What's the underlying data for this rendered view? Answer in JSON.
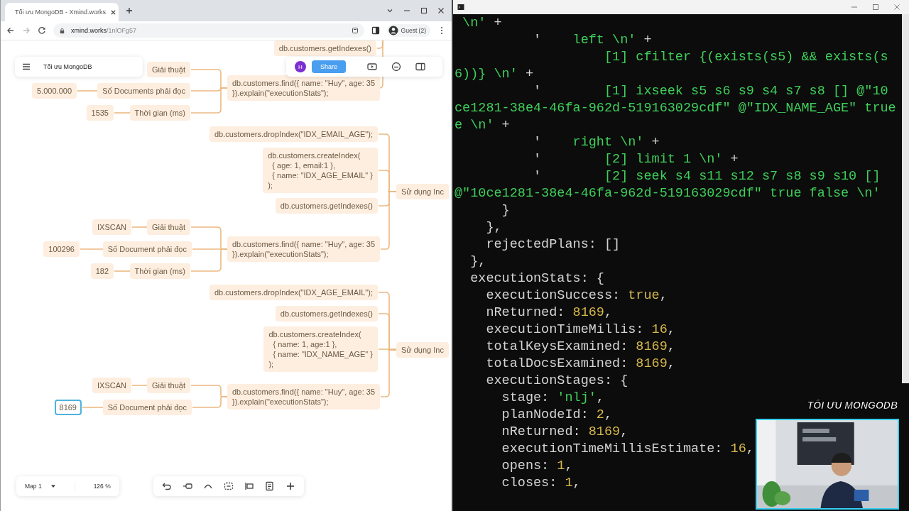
{
  "browser": {
    "tab": {
      "title": "Tối ưu MongoDB - Xmind.works",
      "selected": true
    },
    "url_host": "xmind.works",
    "url_path": "/1nlOFg57",
    "profile": "Guest (2)"
  },
  "app": {
    "title": "Tối ưu MongoDB",
    "avatar": "H",
    "share": "Share",
    "map_tab": "Map 1",
    "zoom": "126 %"
  },
  "mind_map": {
    "branches": [
      {
        "children": [
          {
            "text": "db.customers.getIndexes()",
            "selected": false
          },
          {
            "text": "db.customers.find({ name: \"Huy\", age: 35\n}).explain(\"executionStats\");",
            "selected": false,
            "children": [
              {
                "text": "Giải thuật",
                "selected": false
              },
              {
                "text": "Số Documents phải đọc",
                "selected": false,
                "children": [
                  {
                    "text": "5.000.000",
                    "selected": false
                  }
                ]
              },
              {
                "text": "Thời gian (ms)",
                "selected": false,
                "children": [
                  {
                    "text": "1535",
                    "selected": false
                  }
                ]
              }
            ]
          }
        ]
      },
      {
        "topic": {
          "text": "Sử dụng Inc",
          "selected": false
        },
        "children": [
          {
            "text": "db.customers.dropIndex(\"IDX_EMAIL_AGE\");",
            "selected": false
          },
          {
            "text": "db.customers.createIndex(\n  { age: 1, email:1 },\n  { name: \"IDX_AGE_EMAIL\" }\n);",
            "selected": false
          },
          {
            "text": "db.customers.getIndexes()",
            "selected": false
          },
          {
            "text": "db.customers.find({ name: \"Huy\", age: 35\n}).explain(\"executionStats\");",
            "selected": false,
            "children": [
              {
                "text": "Giải thuật",
                "selected": false,
                "children": [
                  {
                    "text": "IXSCAN",
                    "selected": false
                  }
                ]
              },
              {
                "text": "Số Document phải đọc",
                "selected": false,
                "children": [
                  {
                    "text": "100296",
                    "selected": false
                  }
                ]
              },
              {
                "text": "Thời gian (ms)",
                "selected": false,
                "children": [
                  {
                    "text": "182",
                    "selected": false
                  }
                ]
              }
            ]
          }
        ]
      },
      {
        "topic": {
          "text": "Sử dụng Inc",
          "selected": false
        },
        "children": [
          {
            "text": "db.customers.dropIndex(\"IDX_AGE_EMAIL\");",
            "selected": false
          },
          {
            "text": "db.customers.getIndexes()",
            "selected": false
          },
          {
            "text": "db.customers.createIndex(\n  { name: 1, age:1 },\n  { name: \"IDX_NAME_AGE\" }\n);",
            "selected": false
          },
          {
            "text": "db.customers.find({ name: \"Huy\", age: 35\n}).explain(\"executionStats\");",
            "selected": false,
            "children": [
              {
                "text": "Giải thuật",
                "selected": false,
                "children": [
                  {
                    "text": "IXSCAN",
                    "selected": false
                  }
                ]
              },
              {
                "text": "Số Document phải đọc",
                "selected": false,
                "children": [
                  {
                    "text": "8169",
                    "selected": true
                  }
                ]
              }
            ]
          }
        ]
      }
    ]
  },
  "terminal": {
    "lines": [
      [
        {
          "text": " \\n'",
          "kind": "str"
        },
        {
          "text": " +",
          "kind": "plain"
        }
      ],
      [
        {
          "text": "          '    ",
          "kind": "plain"
        },
        {
          "text": "left \\n'",
          "kind": "str"
        },
        {
          "text": " +",
          "kind": "plain"
        }
      ],
      [
        {
          "text": "                   [1] cfilter {(exists(s5) && exists(s",
          "kind": "str"
        }
      ],
      [
        {
          "text": "6))} \\n'",
          "kind": "str"
        },
        {
          "text": " +",
          "kind": "plain"
        }
      ],
      [
        {
          "text": "          '        ",
          "kind": "plain"
        },
        {
          "text": "[1] ixseek s5 s6 s9 s4 s7 s8 [] @\"10",
          "kind": "str"
        }
      ],
      [
        {
          "text": "ce1281-38e4-46fa-962d-519163029cdf\" @\"IDX_NAME_AGE\" true",
          "kind": "str"
        }
      ],
      [
        {
          "text": "e \\n'",
          "kind": "str"
        },
        {
          "text": " +",
          "kind": "plain"
        }
      ],
      [
        {
          "text": "          '    ",
          "kind": "plain"
        },
        {
          "text": "right \\n'",
          "kind": "str"
        },
        {
          "text": " +",
          "kind": "plain"
        }
      ],
      [
        {
          "text": "          '        ",
          "kind": "plain"
        },
        {
          "text": "[2] limit 1 \\n'",
          "kind": "str"
        },
        {
          "text": " +",
          "kind": "plain"
        }
      ],
      [
        {
          "text": "          '        ",
          "kind": "plain"
        },
        {
          "text": "[2] seek s4 s11 s12 s7 s8 s9 s10 []",
          "kind": "str"
        }
      ],
      [
        {
          "text": "@\"10ce1281-38e4-46fa-962d-519163029cdf\" true false \\n'",
          "kind": "str"
        }
      ],
      [
        {
          "text": "      }",
          "kind": "plain"
        }
      ],
      [
        {
          "text": "    },",
          "kind": "plain"
        }
      ],
      [
        {
          "text": "    rejectedPlans: []",
          "kind": "plain"
        }
      ],
      [
        {
          "text": "  },",
          "kind": "plain"
        }
      ],
      [
        {
          "text": "  executionStats: {",
          "kind": "plain"
        }
      ],
      [
        {
          "text": "    executionSuccess: ",
          "kind": "plain"
        },
        {
          "text": "true",
          "kind": "num"
        },
        {
          "text": ",",
          "kind": "plain"
        }
      ],
      [
        {
          "text": "    nReturned: ",
          "kind": "plain"
        },
        {
          "text": "8169",
          "kind": "num"
        },
        {
          "text": ",",
          "kind": "plain"
        }
      ],
      [
        {
          "text": "    executionTimeMillis: ",
          "kind": "plain"
        },
        {
          "text": "16",
          "kind": "num"
        },
        {
          "text": ",",
          "kind": "plain"
        }
      ],
      [
        {
          "text": "    totalKeysExamined: ",
          "kind": "plain"
        },
        {
          "text": "8169",
          "kind": "num"
        },
        {
          "text": ",",
          "kind": "plain"
        }
      ],
      [
        {
          "text": "    totalDocsExamined: ",
          "kind": "plain"
        },
        {
          "text": "8169",
          "kind": "num"
        },
        {
          "text": ",",
          "kind": "plain"
        }
      ],
      [
        {
          "text": "    executionStages: {",
          "kind": "plain"
        }
      ],
      [
        {
          "text": "      stage: ",
          "kind": "plain"
        },
        {
          "text": "'nlj'",
          "kind": "str"
        },
        {
          "text": ",",
          "kind": "plain"
        }
      ],
      [
        {
          "text": "      planNodeId: ",
          "kind": "plain"
        },
        {
          "text": "2",
          "kind": "num"
        },
        {
          "text": ",",
          "kind": "plain"
        }
      ],
      [
        {
          "text": "      nReturned: ",
          "kind": "plain"
        },
        {
          "text": "8169",
          "kind": "num"
        },
        {
          "text": ",",
          "kind": "plain"
        }
      ],
      [
        {
          "text": "      executionTimeMillisEstimate: ",
          "kind": "plain"
        },
        {
          "text": "16",
          "kind": "num"
        },
        {
          "text": ",",
          "kind": "plain"
        }
      ],
      [
        {
          "text": "      opens: ",
          "kind": "plain"
        },
        {
          "text": "1",
          "kind": "num"
        },
        {
          "text": ",",
          "kind": "plain"
        }
      ],
      [
        {
          "text": "      closes: ",
          "kind": "plain"
        },
        {
          "text": "1",
          "kind": "num"
        },
        {
          "text": ",",
          "kind": "plain"
        }
      ]
    ]
  },
  "video": {
    "caption": "TỐI ƯU MONGODB",
    "kind": "picture"
  }
}
